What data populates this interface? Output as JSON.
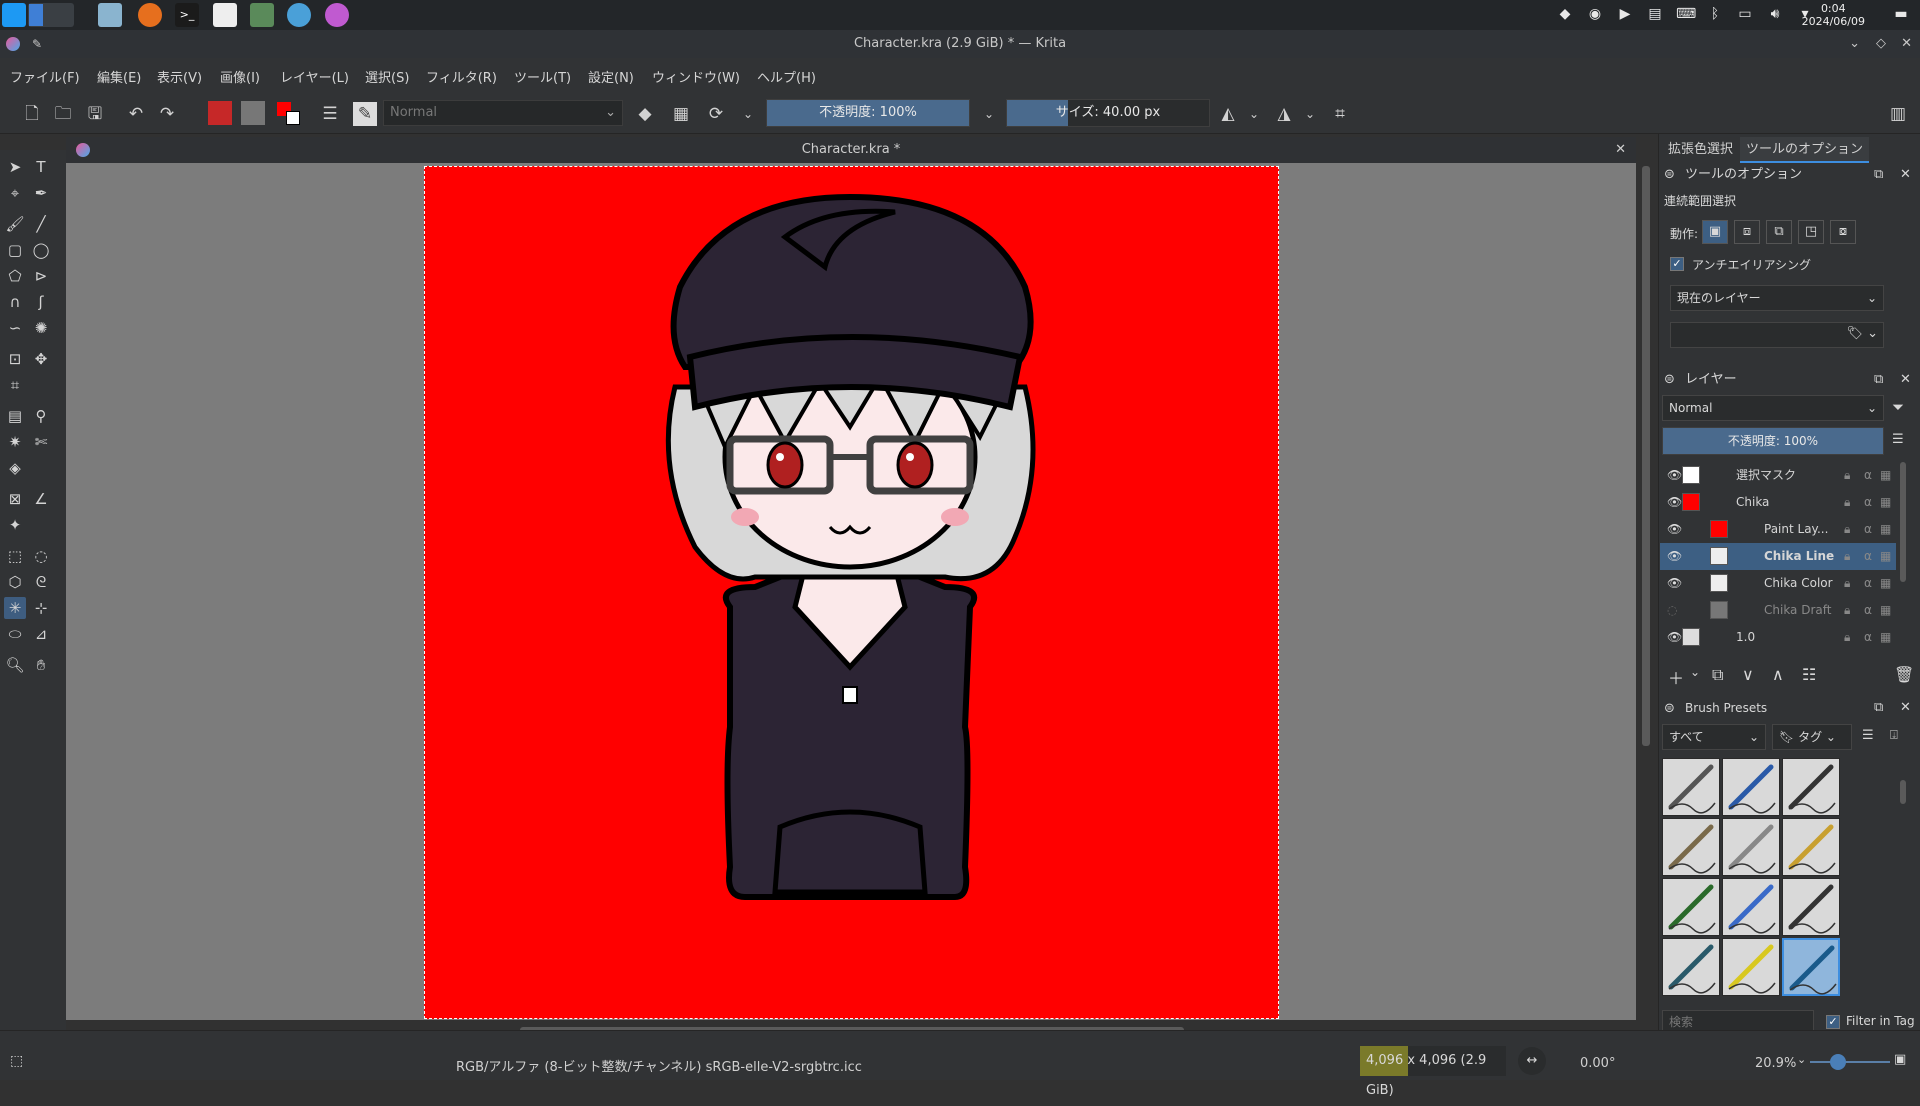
{
  "os": {
    "clock_time": "0:04",
    "clock_date": "2024/06/09"
  },
  "window": {
    "title": "Character.kra (2.9 GiB) * — Krita"
  },
  "menu": [
    "ファイル(F)",
    "編集(E)",
    "表示(V)",
    "画像(I)",
    "レイヤー(L)",
    "選択(S)",
    "フィルタ(R)",
    "ツール(T)",
    "設定(N)",
    "ウィンドウ(W)",
    "ヘルプ(H)"
  ],
  "toolbar": {
    "blend_mode": "Normal",
    "opacity_label": "不透明度: 100%",
    "opacity_value": 100,
    "size_label": "サイズ: 40.00 px",
    "size_fraction": 0.3
  },
  "document": {
    "tab_title": "Character.kra *",
    "canvas_color": "#ff0000"
  },
  "dock_tabs": [
    "拡張色選択",
    "ツールのオプション"
  ],
  "tool_options": {
    "header": "ツールのオプション",
    "tool_name": "連続範囲選択",
    "action_label": "動作:",
    "antialias_label": "アンチエイリアシング",
    "antialias_checked": true,
    "source_select": "現在のレイヤー"
  },
  "layers": {
    "header": "レイヤー",
    "blend_mode": "Normal",
    "opacity_label": "不透明度: 100%",
    "items": [
      {
        "name": "選択マスク",
        "thumb": "mask"
      },
      {
        "name": "Chika",
        "thumb": "red"
      },
      {
        "name": "Paint Lay...",
        "thumb": "red"
      },
      {
        "name": "Chika Line",
        "thumb": "line",
        "selected": true
      },
      {
        "name": "Chika Color",
        "thumb": "line"
      },
      {
        "name": "Chika Draft",
        "thumb": "grey",
        "hidden": true
      },
      {
        "name": "1.0",
        "thumb": "checker"
      }
    ]
  },
  "brush_presets": {
    "header": "Brush Presets",
    "filter_select": "すべて",
    "tag_button": "タグ",
    "search_placeholder": "検索",
    "filter_in_tag_label": "Filter in Tag"
  },
  "status": {
    "color_space": "RGB/アルファ (8-ビット整数/チャンネル)  sRGB-elle-V2-srgbtrc.icc",
    "image_size": "4,096 x 4,096 (2.9 GiB)",
    "rotation": "0.00°",
    "zoom": "20.9%"
  }
}
